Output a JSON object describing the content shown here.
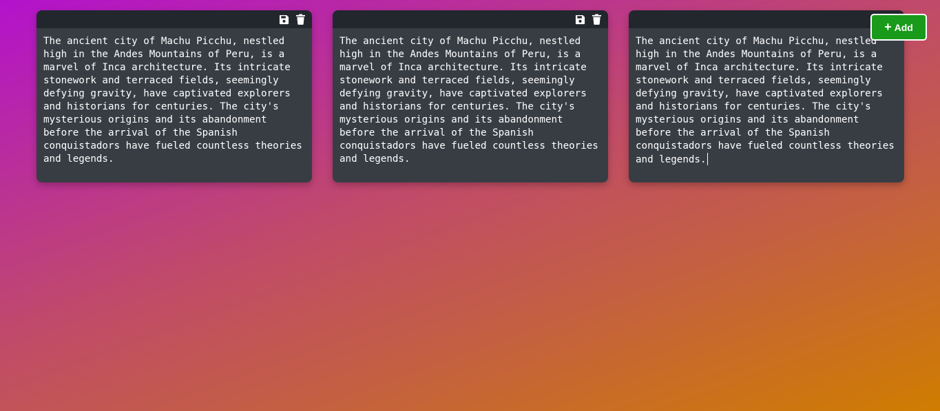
{
  "toolbar": {
    "add_label": "Add",
    "add_icon": "plus-icon",
    "add_color": "#1a9a1a"
  },
  "notes": [
    {
      "text": "The ancient city of Machu Picchu, nestled high in the Andes Mountains of Peru, is a marvel of Inca architecture. Its intricate stonework and terraced fields, seemingly defying gravity, have captivated explorers and historians for centuries. The city's mysterious origins and its abandonment before the arrival of the Spanish conquistadors have fueled countless theories and legends.",
      "icons": [
        "save-icon",
        "trash-icon"
      ]
    },
    {
      "text": "The ancient city of Machu Picchu, nestled high in the Andes Mountains of Peru, is a marvel of Inca architecture. Its intricate stonework and terraced fields, seemingly defying gravity, have captivated explorers and historians for centuries. The city's mysterious origins and its abandonment before the arrival of the Spanish conquistadors have fueled countless theories and legends.",
      "icons": [
        "save-icon",
        "trash-icon"
      ]
    },
    {
      "text": "The ancient city of Machu Picchu, nestled high in the Andes Mountains of Peru, is a marvel of Inca architecture. Its intricate stonework and terraced fields, seemingly defying gravity, have captivated explorers and historians for centuries. The city's mysterious origins and its abandonment before the arrival of the Spanish conquistadors have fueled countless theories and legends.",
      "icons": []
    }
  ],
  "colors": {
    "note_bg": "#383d44",
    "toolbar_bg": "#22262d",
    "text": "#ffffff"
  }
}
